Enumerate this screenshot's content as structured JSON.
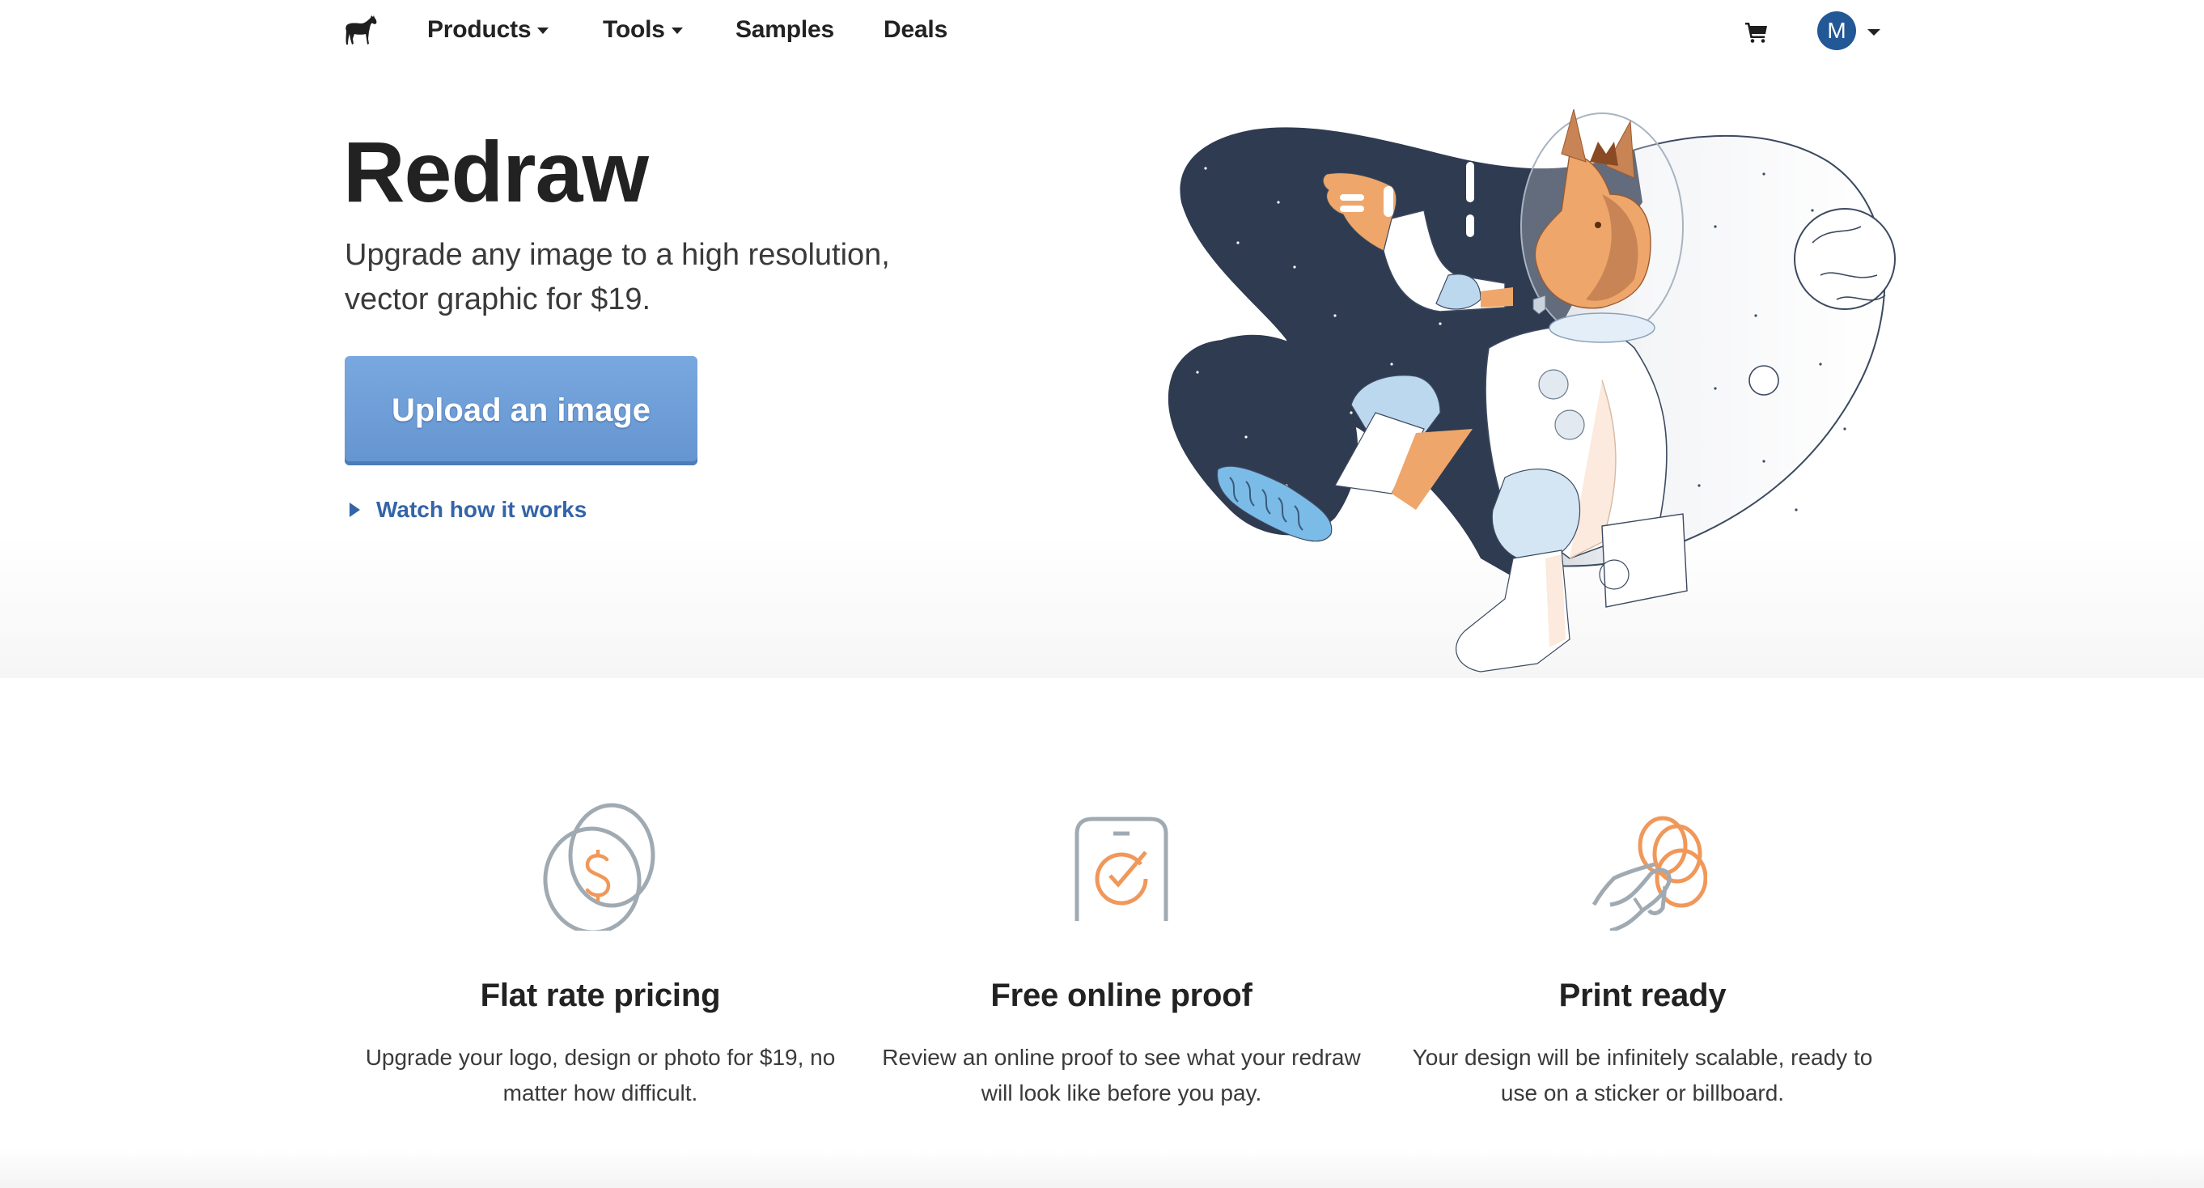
{
  "nav": {
    "logo": "horse-logo",
    "items": [
      {
        "label": "Products",
        "has_dropdown": true
      },
      {
        "label": "Tools",
        "has_dropdown": true
      },
      {
        "label": "Samples",
        "has_dropdown": false
      },
      {
        "label": "Deals",
        "has_dropdown": false
      }
    ],
    "cart_icon": "shopping-cart-icon",
    "avatar_initial": "M",
    "avatar_color": "#225896"
  },
  "hero": {
    "title": "Redraw",
    "subtitle": "Upgrade any image to a high resolution, vector graphic for $19.",
    "cta_label": "Upload an image",
    "cta_color": "#6f9fd9",
    "watch_label": "Watch how it works",
    "illustration": "astronaut-horse-illustration"
  },
  "features": [
    {
      "icon": "coins-dollar-icon",
      "title": "Flat rate pricing",
      "description": "Upgrade your logo, design or photo for $19, no matter how difficult."
    },
    {
      "icon": "phone-checkmark-icon",
      "title": "Free online proof",
      "description": "Review an online proof to see what your redraw will look like before you pay."
    },
    {
      "icon": "hand-stickers-icon",
      "title": "Print ready",
      "description": "Your design will be infinitely scalable, ready to use on a sticker or billboard."
    }
  ],
  "colors": {
    "accent_orange": "#f0985a",
    "icon_gray": "#a0aab2",
    "link_blue": "#3464a8",
    "space_navy": "#2e3b50"
  }
}
